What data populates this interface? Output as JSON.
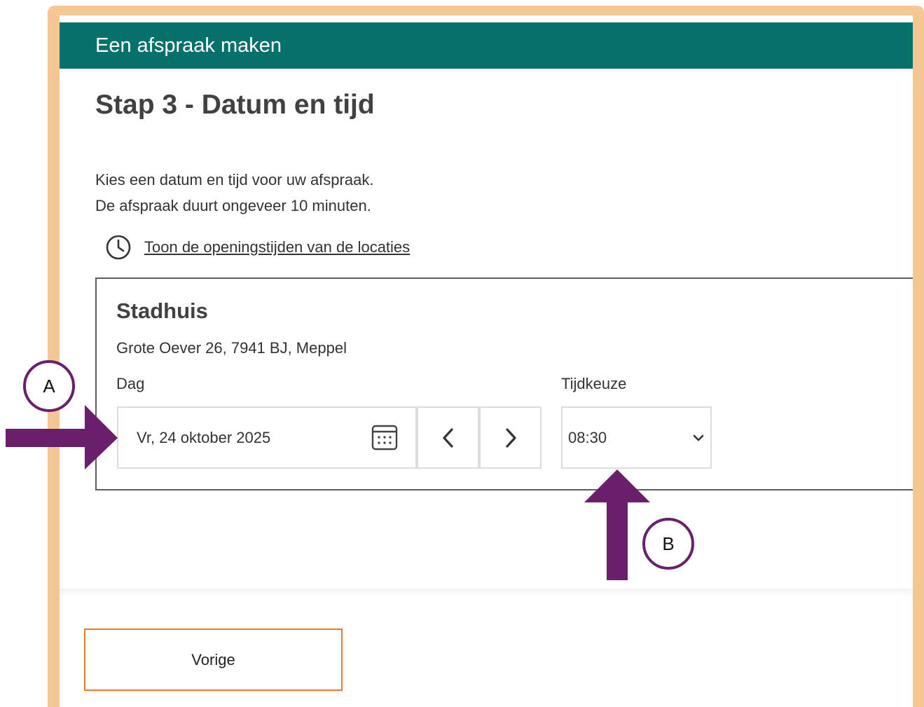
{
  "header": {
    "title": "Een afspraak maken"
  },
  "step": {
    "title": "Stap 3 - Datum en tijd"
  },
  "intro": {
    "line1": "Kies een datum en tijd voor uw afspraak.",
    "line2": "De afspraak duurt ongeveer 10 minuten."
  },
  "hours_link": {
    "label": "Toon de openingstijden van de locaties",
    "icon": "clock-icon"
  },
  "location": {
    "name": "Stadhuis",
    "address": "Grote Oever 26, 7941 BJ, Meppel",
    "day_label": "Dag",
    "day_value": "Vr, 24 oktober 2025",
    "time_label": "Tijdkeuze",
    "time_value": "08:30"
  },
  "footer": {
    "previous_label": "Vorige"
  },
  "annotations": {
    "a": "A",
    "b": "B"
  },
  "colors": {
    "header_bg": "#06706b",
    "frame": "#f5c893",
    "arrow": "#6a1f6b",
    "button_border": "#e57a2c"
  }
}
